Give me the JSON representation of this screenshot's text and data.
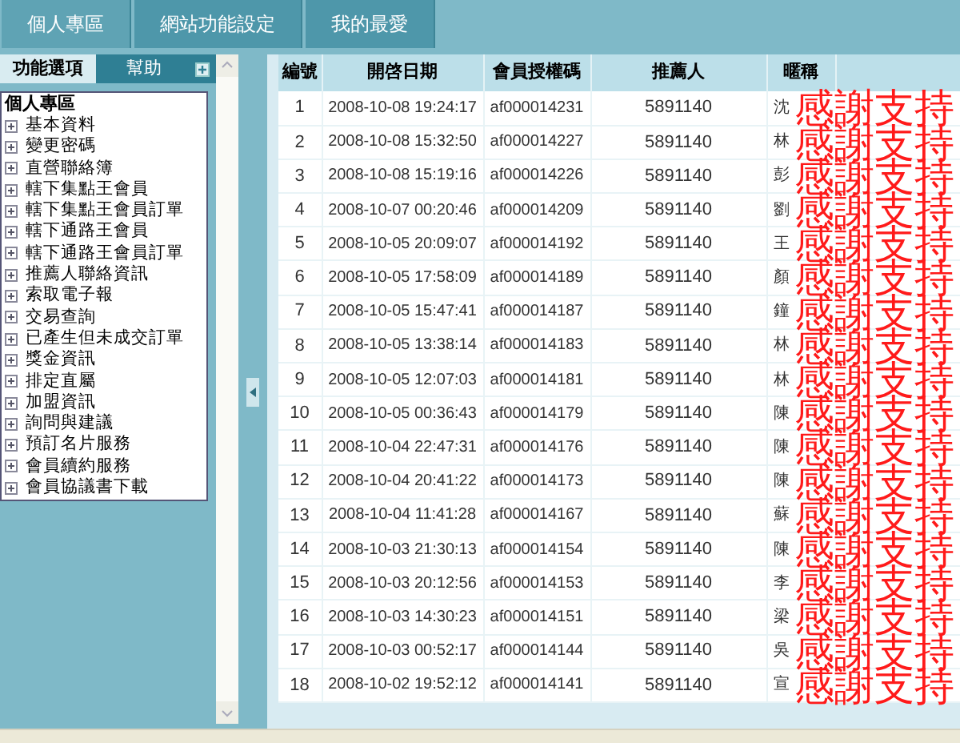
{
  "top_tabs": [
    {
      "label": "個人專區",
      "selected": true
    },
    {
      "label": "網站功能設定",
      "selected": false
    },
    {
      "label": "我的最愛",
      "selected": false
    }
  ],
  "panel_tabs": [
    {
      "label": "功能選項",
      "selected": true
    },
    {
      "label": "幫助",
      "selected": false
    }
  ],
  "menu": {
    "title": "個人專區",
    "items": [
      "基本資料",
      "變更密碼",
      "直營聯絡簿",
      "轄下集點王會員",
      "轄下集點王會員訂單",
      "轄下通路王會員",
      "轄下通路王會員訂單",
      "推薦人聯絡資訊",
      "索取電子報",
      "交易查詢",
      "已產生但未成交訂單",
      "獎金資訊",
      "排定直屬",
      "加盟資訊",
      "詢問與建議",
      "預訂名片服務",
      "會員續約服務",
      "會員協議書下載"
    ]
  },
  "table": {
    "columns": [
      "編號",
      "開啓日期",
      "會員授權碼",
      "推薦人",
      "暱稱"
    ],
    "rows": [
      {
        "no": "1",
        "date": "2008-10-08 19:24:17",
        "code": "af000014231",
        "referrer": "5891140",
        "nickname": "沈",
        "overlay": "感謝支持"
      },
      {
        "no": "2",
        "date": "2008-10-08 15:32:50",
        "code": "af000014227",
        "referrer": "5891140",
        "nickname": "林",
        "overlay": "感謝支持"
      },
      {
        "no": "3",
        "date": "2008-10-08 15:19:16",
        "code": "af000014226",
        "referrer": "5891140",
        "nickname": "彭",
        "overlay": "感謝支持"
      },
      {
        "no": "4",
        "date": "2008-10-07 00:20:46",
        "code": "af000014209",
        "referrer": "5891140",
        "nickname": "劉",
        "overlay": "感謝支持"
      },
      {
        "no": "5",
        "date": "2008-10-05 20:09:07",
        "code": "af000014192",
        "referrer": "5891140",
        "nickname": "王",
        "overlay": "感謝支持"
      },
      {
        "no": "6",
        "date": "2008-10-05 17:58:09",
        "code": "af000014189",
        "referrer": "5891140",
        "nickname": "顏",
        "overlay": "感謝支持"
      },
      {
        "no": "7",
        "date": "2008-10-05 15:47:41",
        "code": "af000014187",
        "referrer": "5891140",
        "nickname": "鐘",
        "overlay": "感謝支持"
      },
      {
        "no": "8",
        "date": "2008-10-05 13:38:14",
        "code": "af000014183",
        "referrer": "5891140",
        "nickname": "林",
        "overlay": "感謝支持"
      },
      {
        "no": "9",
        "date": "2008-10-05 12:07:03",
        "code": "af000014181",
        "referrer": "5891140",
        "nickname": "林",
        "overlay": "感謝支持"
      },
      {
        "no": "10",
        "date": "2008-10-05 00:36:43",
        "code": "af000014179",
        "referrer": "5891140",
        "nickname": "陳",
        "overlay": "感謝支持"
      },
      {
        "no": "11",
        "date": "2008-10-04 22:47:31",
        "code": "af000014176",
        "referrer": "5891140",
        "nickname": "陳",
        "overlay": "感謝支持"
      },
      {
        "no": "12",
        "date": "2008-10-04 20:41:22",
        "code": "af000014173",
        "referrer": "5891140",
        "nickname": "陳",
        "overlay": "感謝支持"
      },
      {
        "no": "13",
        "date": "2008-10-04 11:41:28",
        "code": "af000014167",
        "referrer": "5891140",
        "nickname": "蘇",
        "overlay": "感謝支持"
      },
      {
        "no": "14",
        "date": "2008-10-03 21:30:13",
        "code": "af000014154",
        "referrer": "5891140",
        "nickname": "陳",
        "overlay": "感謝支持"
      },
      {
        "no": "15",
        "date": "2008-10-03 20:12:56",
        "code": "af000014153",
        "referrer": "5891140",
        "nickname": "李",
        "overlay": "感謝支持"
      },
      {
        "no": "16",
        "date": "2008-10-03 14:30:23",
        "code": "af000014151",
        "referrer": "5891140",
        "nickname": "梁",
        "overlay": "感謝支持"
      },
      {
        "no": "17",
        "date": "2008-10-03 00:52:17",
        "code": "af000014144",
        "referrer": "5891140",
        "nickname": "吳",
        "overlay": "感謝支持"
      },
      {
        "no": "18",
        "date": "2008-10-02 19:52:12",
        "code": "af000014141",
        "referrer": "5891140",
        "nickname": "宣",
        "overlay": "感謝支持"
      }
    ]
  }
}
